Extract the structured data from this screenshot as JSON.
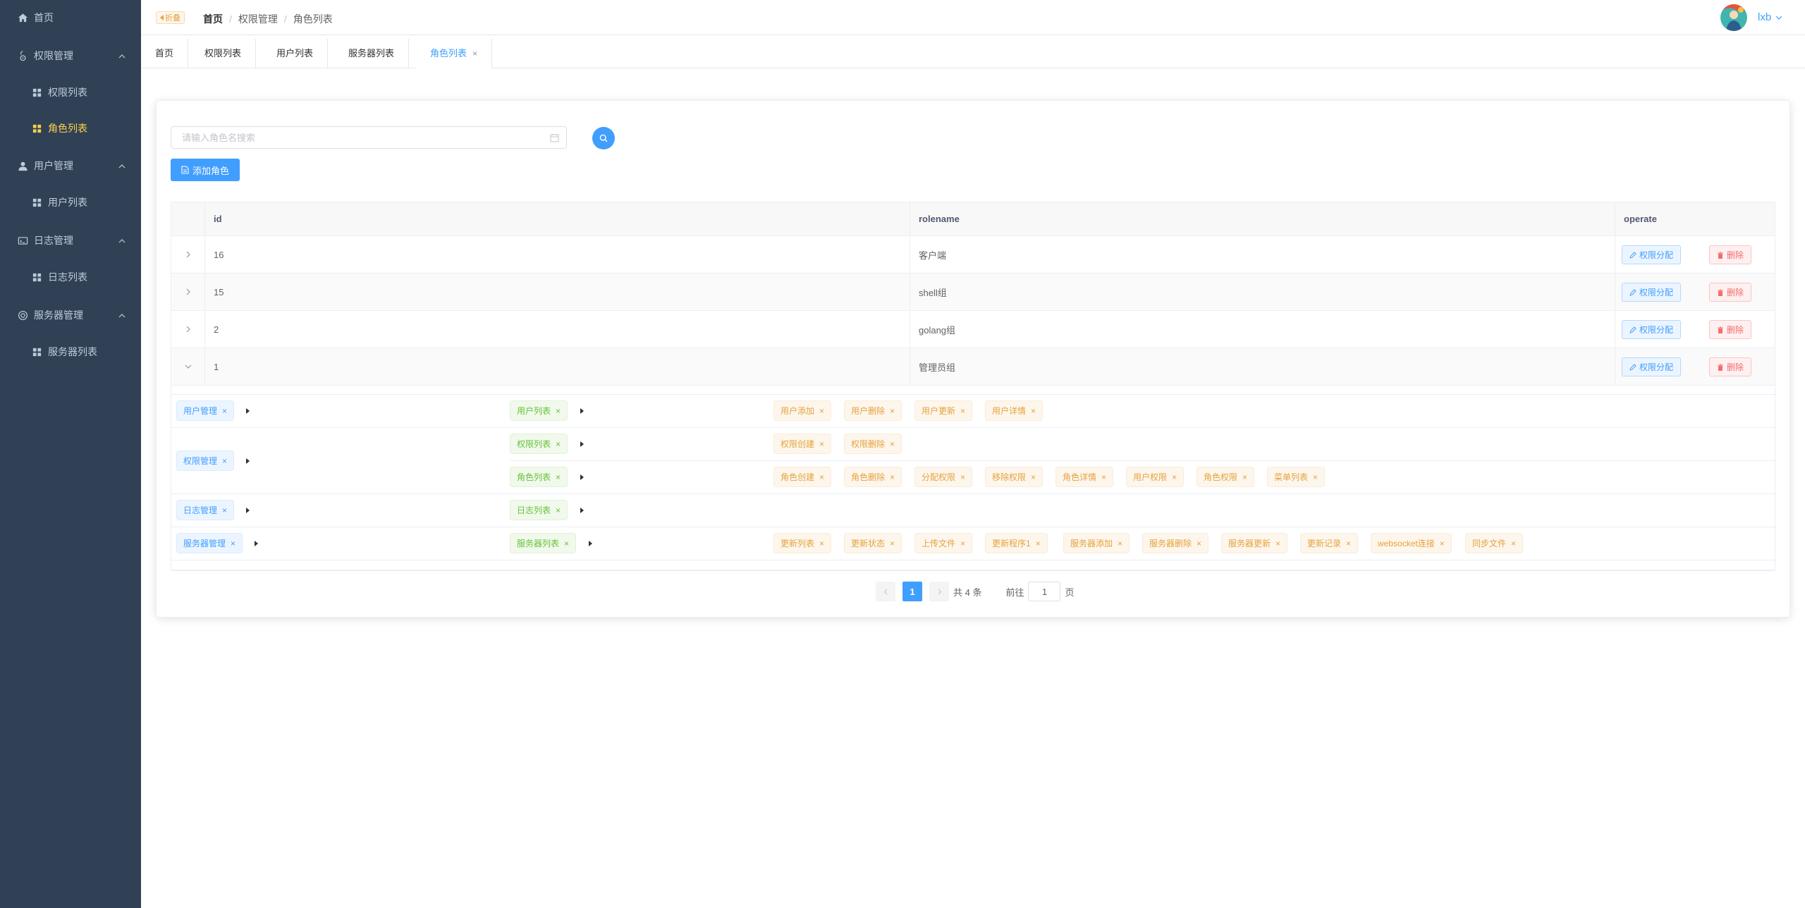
{
  "sidebar": {
    "items": [
      {
        "label": "首页",
        "icon": "home-icon"
      },
      {
        "label": "权限管理",
        "icon": "lock-icon"
      },
      {
        "label": "权限列表",
        "icon": "grid-icon"
      },
      {
        "label": "角色列表",
        "icon": "grid-icon",
        "active": true
      },
      {
        "label": "用户管理",
        "icon": "user-icon"
      },
      {
        "label": "用户列表",
        "icon": "grid-icon"
      },
      {
        "label": "日志管理",
        "icon": "log-icon"
      },
      {
        "label": "日志列表",
        "icon": "grid-icon"
      },
      {
        "label": "服务器管理",
        "icon": "server-icon"
      },
      {
        "label": "服务器列表",
        "icon": "grid-icon"
      }
    ]
  },
  "header": {
    "fold_label": "折叠",
    "breadcrumb": [
      "首页",
      "权限管理",
      "角色列表"
    ],
    "user_name": "lxb"
  },
  "tabs": [
    {
      "label": "首页"
    },
    {
      "label": "权限列表"
    },
    {
      "label": "用户列表"
    },
    {
      "label": "服务器列表"
    },
    {
      "label": "角色列表",
      "active": true,
      "close": "×"
    }
  ],
  "search": {
    "placeholder": "请输入角色名搜索",
    "value": ""
  },
  "add_role_label": "添加角色",
  "table": {
    "columns": {
      "id": "id",
      "rolename": "rolename",
      "operate": "operate"
    },
    "assign_label": "权限分配",
    "delete_label": "删除",
    "rows": [
      {
        "id": "16",
        "rolename": "客户端"
      },
      {
        "id": "15",
        "rolename": "shell组"
      },
      {
        "id": "2",
        "rolename": "golang组"
      },
      {
        "id": "1",
        "rolename": "管理员组"
      }
    ],
    "expanded": {
      "l1": [
        "用户管理",
        "权限管理",
        "日志管理",
        "服务器管理"
      ],
      "l2": [
        "用户列表",
        "权限列表",
        "角色列表",
        "日志列表",
        "服务器列表"
      ],
      "l3_user_list": [
        "用户添加",
        "用户删除",
        "用户更新",
        "用户详情"
      ],
      "l3_perm_list": [
        "权限创建",
        "权限删除"
      ],
      "l3_role_list": [
        "角色创建",
        "角色删除",
        "分配权限",
        "移除权限",
        "角色详情",
        "用户权限",
        "角色权限",
        "菜单列表"
      ],
      "l3_server_list": [
        "更新列表",
        "更新状态",
        "上传文件",
        "更新程序1",
        "服务器添加",
        "服务器删除",
        "服务器更新",
        "更新记录",
        "websocket连接",
        "同步文件"
      ],
      "close": "×"
    }
  },
  "pagination": {
    "current": "1",
    "total_text": "共 4 条",
    "goto_prefix": "前往",
    "goto_value": "1",
    "goto_suffix": "页"
  },
  "colors": {
    "sidebar_bg": "#304156",
    "sidebar_text": "#bfcbd9",
    "sidebar_active": "#ffd04b",
    "primary": "#409eff",
    "danger": "#f56c6c",
    "success": "#67c23a",
    "warning": "#e6a23c"
  }
}
